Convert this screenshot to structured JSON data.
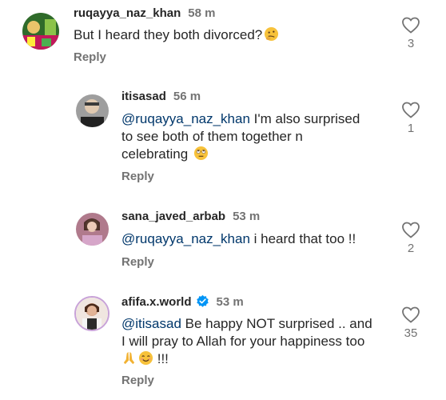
{
  "comments": [
    {
      "username": "ruqayya_naz_khan",
      "time": "58 m",
      "mention": "",
      "text": "But I heard they both divorced?",
      "emoji_after": "thinking-emoji",
      "reply_label": "Reply",
      "likes": "3",
      "verified": false,
      "avatar": "avatar-ruqayya"
    },
    {
      "username": "itisasad",
      "time": "56 m",
      "mention": "@ruqayya_naz_khan",
      "text": " I'm also surprised",
      "text_line2": "to see both of them together n",
      "text_line3": "celebrating",
      "emoji_after": "eye-roll-emoji",
      "reply_label": "Reply",
      "likes": "1",
      "verified": false,
      "avatar": "avatar-itisasad"
    },
    {
      "username": "sana_javed_arbab",
      "time": "53 m",
      "mention": "@ruqayya_naz_khan",
      "text": " i heard that too !!",
      "reply_label": "Reply",
      "likes": "2",
      "verified": false,
      "avatar": "avatar-sana"
    },
    {
      "username": "afifa.x.world",
      "time": "53 m",
      "mention": "@itisasad",
      "text": " Be happy NOT surprised .. and",
      "text_line2": "I will pray to Allah for your happiness too",
      "text_line3": "!!!",
      "emoji_line3": [
        "folded-hands-emoji",
        "smiling-emoji"
      ],
      "reply_label": "Reply",
      "likes": "35",
      "verified": true,
      "avatar": "avatar-afifa"
    }
  ],
  "colors": {
    "username": "#262626",
    "muted": "#737373",
    "mention": "#00376b",
    "verified": "#0095f6"
  }
}
